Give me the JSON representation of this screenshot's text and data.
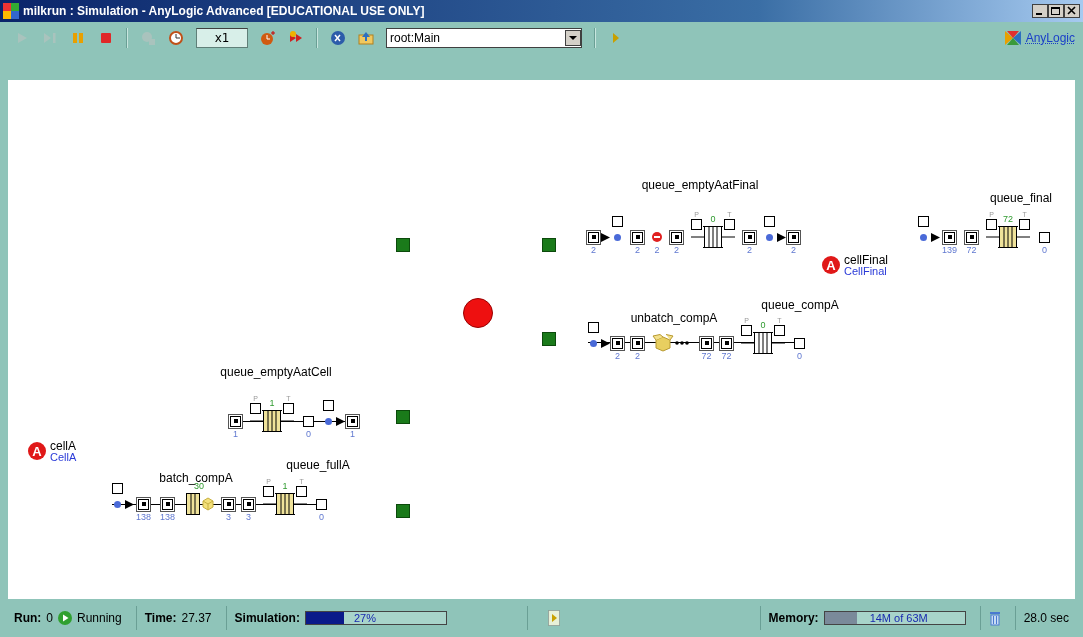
{
  "window": {
    "title": "milkrun : Simulation - AnyLogic Advanced [EDUCATIONAL USE ONLY]"
  },
  "toolbar": {
    "items": [
      {
        "kind": "run",
        "disabled": true
      },
      {
        "kind": "step",
        "disabled": true
      },
      {
        "kind": "pause",
        "disabled": false
      },
      {
        "kind": "stop",
        "disabled": false
      },
      {
        "kind": "separator"
      },
      {
        "kind": "virtual",
        "disabled": true
      },
      {
        "kind": "realtime",
        "disabled": false
      },
      {
        "kind": "speed",
        "value": "x1"
      },
      {
        "kind": "slower",
        "disabled": false
      },
      {
        "kind": "faster",
        "disabled": false
      },
      {
        "kind": "separator"
      },
      {
        "kind": "back",
        "disabled": false
      },
      {
        "kind": "up",
        "disabled": false
      },
      {
        "kind": "select",
        "value": "root:Main"
      },
      {
        "kind": "separator"
      },
      {
        "kind": "more",
        "disabled": false
      }
    ],
    "brand": "AnyLogic"
  },
  "diagram": {
    "block_names": [
      "queue_emptyAatFinal",
      "queue_final",
      "unbatch_compA",
      "queue_compA",
      "queue_emptyAatCell",
      "batch_compA",
      "queue_fullA"
    ],
    "chains": [
      {
        "nodes": [
          {
            "kind": "port",
            "count": "2"
          },
          {
            "kind": "arrow"
          },
          {
            "kind": "dot"
          },
          {
            "kind": "port",
            "count": "2"
          },
          {
            "kind": "hold",
            "count": "2"
          },
          {
            "kind": "port",
            "count": "2"
          },
          {
            "kind": "queue",
            "p": "P",
            "t": "T",
            "count": "0",
            "filled": false
          },
          {
            "kind": "port",
            "count": "2"
          },
          {
            "kind": "dot"
          },
          {
            "kind": "arrow"
          },
          {
            "kind": "port",
            "count": "2"
          }
        ]
      },
      {
        "nodes": [
          {
            "kind": "dot"
          },
          {
            "kind": "arrow"
          },
          {
            "kind": "port",
            "count": "139"
          },
          {
            "kind": "port",
            "count": "72"
          },
          {
            "kind": "queue",
            "p": "P",
            "t": "T",
            "count": "72",
            "filled": true
          },
          {
            "kind": "sink",
            "count": "0"
          }
        ]
      },
      {
        "nodes": [
          {
            "kind": "dot"
          },
          {
            "kind": "arrow"
          },
          {
            "kind": "port",
            "count": "2"
          },
          {
            "kind": "port",
            "count": "2"
          },
          {
            "kind": "unbatch"
          },
          {
            "kind": "port",
            "count": "72"
          },
          {
            "kind": "port",
            "count": "72"
          },
          {
            "kind": "queue",
            "p": "P",
            "t": "T",
            "count": "0",
            "filled": false
          },
          {
            "kind": "sink",
            "count": "0"
          }
        ]
      },
      {
        "nodes": [
          {
            "kind": "port",
            "count": "1"
          },
          {
            "kind": "queue",
            "p": "P",
            "t": "T",
            "count": "1",
            "filled": true
          },
          {
            "kind": "sink",
            "count": "0"
          },
          {
            "kind": "dot"
          },
          {
            "kind": "arrow"
          },
          {
            "kind": "port",
            "count": "1"
          }
        ]
      },
      {
        "nodes": [
          {
            "kind": "dot"
          },
          {
            "kind": "arrow"
          },
          {
            "kind": "port",
            "count": "138"
          },
          {
            "kind": "port",
            "count": "138"
          },
          {
            "kind": "batch",
            "count": "30"
          },
          {
            "kind": "port",
            "count": "3"
          },
          {
            "kind": "port",
            "count": "3"
          },
          {
            "kind": "queue",
            "p": "P",
            "t": "T",
            "count": "1",
            "filled": true
          },
          {
            "kind": "sink",
            "count": "0"
          }
        ]
      }
    ],
    "agents": [
      {
        "badge": "A",
        "name": "cellFinal",
        "type": "CellFinal"
      },
      {
        "badge": "A",
        "name": "cellA",
        "type": "CellA"
      }
    ]
  },
  "status_bar": {
    "run": {
      "label": "Run:",
      "value": "0",
      "state": "Running"
    },
    "time": {
      "label": "Time:",
      "value": "27.37"
    },
    "simulation": {
      "label": "Simulation:",
      "level": 0.27,
      "reading": "27%"
    },
    "memory": {
      "label": "Memory:",
      "level": 0.23,
      "reading": "14M of 63M"
    },
    "elapsed": "28.0 sec"
  }
}
